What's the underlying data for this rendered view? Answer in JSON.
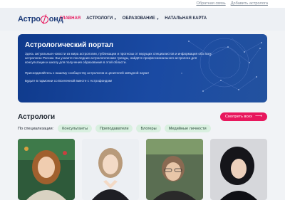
{
  "toplinks": {
    "feedback": "Обратная связь",
    "add_astrologer": "Добавить астролога"
  },
  "logo": {
    "part1": "Астро",
    "part2": "онд"
  },
  "nav": [
    {
      "label": "ГЛАВНАЯ"
    },
    {
      "label": "АСТРОЛОГИ",
      "dropdown": true
    },
    {
      "label": "ОБРАЗОВАНИЕ",
      "dropdown": true
    },
    {
      "label": "НАТАЛЬНАЯ КАРТА"
    }
  ],
  "hero": {
    "title": "Астрологический портал",
    "p1": "Здесь актуальные новости из мира астрологии, публикации и прогнозы от ведущих специалистов и информация обо всех астрологах России. Вы узнаете последние астрологические тренды, найдёте профессионального астролога для консультации и школу для получения образования в этой области.",
    "p2": "Присоединяйтесь к нашему сообществу астрологов и ценителей звёздной науки!",
    "p3": "Будьте в гармонии со Вселенной вместе с Астрофондом!"
  },
  "section": {
    "title": "Астрологи",
    "see_all": "Смотреть всех"
  },
  "filters": {
    "label": "По специализации:",
    "chips": [
      "Консультанты",
      "Преподаватели",
      "Блогеры",
      "Медийные личности"
    ]
  },
  "colors": {
    "accent": "#e8175d",
    "brand_blue": "#1f3d7a",
    "chip_bg": "#d9f0e0"
  }
}
